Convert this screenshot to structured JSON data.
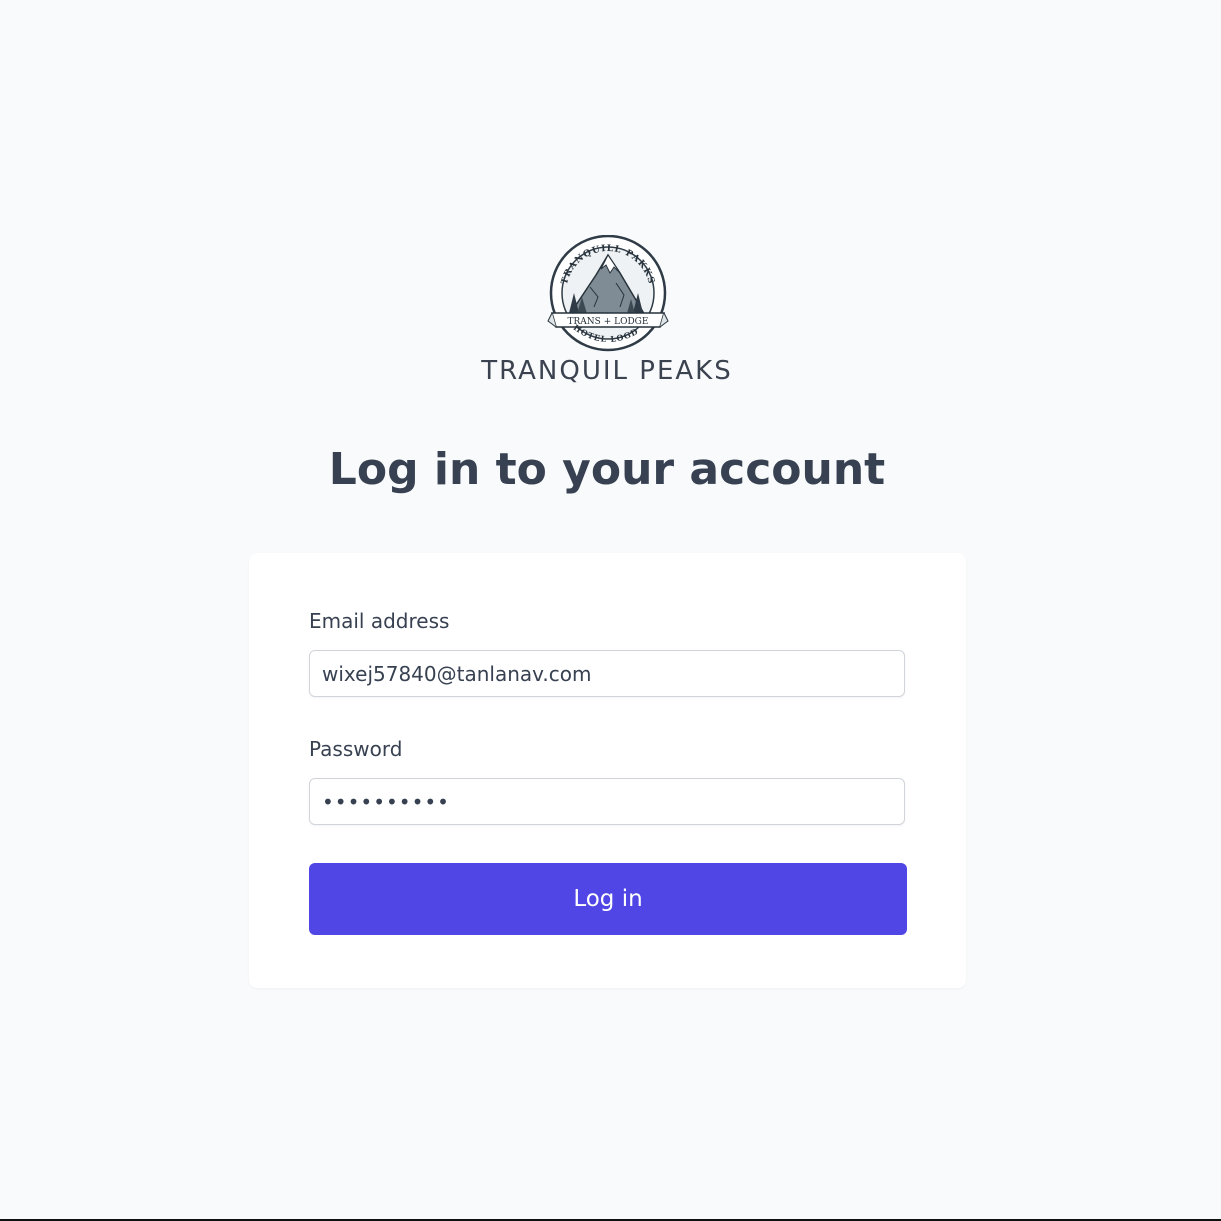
{
  "brand": {
    "logo_icon": "mountain-emblem-icon",
    "logo_arc_top": "TRANQUILL PAKKS",
    "logo_banner": "TRANS + LODGE",
    "logo_arc_bottom": "HOTEL LOGDE",
    "name": "TRANQUIL PEAKS"
  },
  "page": {
    "title": "Log in to your account"
  },
  "form": {
    "email": {
      "label": "Email address",
      "value": "wixej57840@tanlanav.com"
    },
    "password": {
      "label": "Password",
      "value": "••••••••••"
    },
    "submit_label": "Log in"
  },
  "colors": {
    "background": "#f9fafb",
    "card": "#ffffff",
    "primary": "#4f46e5",
    "text": "#374151"
  }
}
